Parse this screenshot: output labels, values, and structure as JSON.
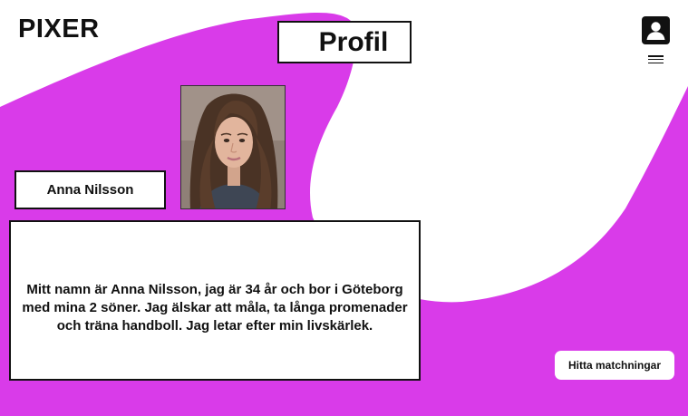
{
  "app": {
    "logo": "PIXER"
  },
  "header": {
    "title": "Profil",
    "user_icon": "user-square-icon",
    "menu_icon": "hamburger-menu-icon"
  },
  "profile": {
    "name": "Anna Nilsson",
    "photo": "profile-photo",
    "bio": "Mitt namn är Anna Nilsson, jag är 34 år och bor i Göteborg med mina 2 söner. Jag älskar att måla, ta långa promenader och träna handboll. Jag letar efter min livskärlek."
  },
  "actions": {
    "find_matches_label": "Hitta matchningar"
  },
  "colors": {
    "brand": "#d93be9",
    "surface": "#ffffff",
    "text": "#111111"
  }
}
